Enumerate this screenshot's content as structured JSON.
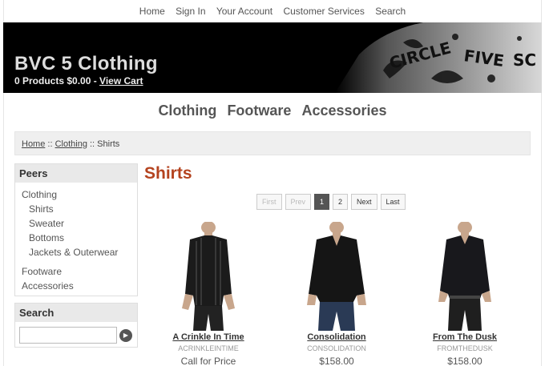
{
  "topnav": {
    "items": [
      "Home",
      "Sign In",
      "Your Account",
      "Customer Services",
      "Search"
    ]
  },
  "header": {
    "brand": "BVC 5 Clothing",
    "cart_text": "0 Products $0.00 - ",
    "cart_link": "View Cart"
  },
  "categories": [
    "Clothing",
    "Footware",
    "Accessories"
  ],
  "breadcrumb": {
    "home": "Home",
    "sep": " :: ",
    "clothing": "Clothing",
    "current": "Shirts"
  },
  "sidebar": {
    "peers_title": "Peers",
    "items": [
      {
        "label": "Clothing"
      },
      {
        "label": "Shirts"
      },
      {
        "label": "Sweater"
      },
      {
        "label": "Bottoms"
      },
      {
        "label": "Jackets & Outerwear"
      },
      {
        "label": "Footware"
      },
      {
        "label": "Accessories"
      }
    ],
    "search_title": "Search",
    "search_button_icon": "play-arrow-icon"
  },
  "page_title": "Shirts",
  "pager": {
    "first": "First",
    "prev": "Prev",
    "pages": [
      "1",
      "2"
    ],
    "next": "Next",
    "last": "Last",
    "current": 1
  },
  "products": [
    {
      "name": "A Crinkle In Time",
      "sku": "ACRINKLEINTIME",
      "price": "Call for Price"
    },
    {
      "name": "Consolidation",
      "sku": "CONSOLIDATION",
      "price": "$158.00"
    },
    {
      "name": "From The Dusk",
      "sku": "FROMTHEDUSK",
      "price": "$158.00"
    }
  ]
}
